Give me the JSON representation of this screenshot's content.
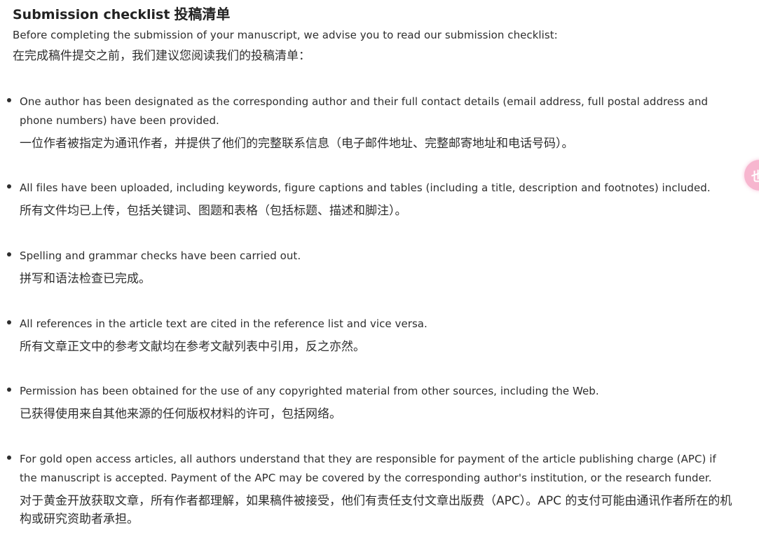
{
  "page": {
    "title_en": "Submission checklist",
    "title_zh": "投稿清单",
    "intro_en": "Before completing the submission of your manuscript, we advise you to read our submission checklist:",
    "intro_zh": "在完成稿件提交之前，我们建议您阅读我们的投稿清单："
  },
  "checklist": [
    {
      "en": "One author has been designated as the corresponding author and their full contact details (email address, full postal address and phone numbers) have been provided.",
      "zh": "一位作者被指定为通讯作者，并提供了他们的完整联系信息（电子邮件地址、完整邮寄地址和电话号码）。"
    },
    {
      "en": "All files have been uploaded, including keywords, figure captions and tables (including a title, description and footnotes) included.",
      "zh": "所有文件均已上传，包括关键词、图题和表格（包括标题、描述和脚注）。"
    },
    {
      "en": "Spelling and grammar checks have been carried out.",
      "zh": "拼写和语法检查已完成。"
    },
    {
      "en": "All references in the article text are cited in the reference list and vice versa.",
      "zh": "所有文章正文中的参考文献均在参考文献列表中引用，反之亦然。"
    },
    {
      "en": "Permission has been obtained for the use of any copyrighted material from other sources, including the Web.",
      "zh": "已获得使用来自其他来源的任何版权材料的许可，包括网络。"
    },
    {
      "en": "For gold open access articles, all authors understand that they are responsible for payment of the article publishing charge (APC) if the manuscript is accepted. Payment of the APC may be covered by the corresponding author's institution, or the research funder.",
      "zh": "对于黄金开放获取文章，所有作者都理解，如果稿件被接受，他们有责任支付文章出版费（APC）。APC 的支付可能由通讯作者所在的机构或研究资助者承担。"
    }
  ],
  "side_widget": {
    "glyph": "也",
    "color": "#f7b6cf",
    "icon": "floating-assistant-icon"
  }
}
